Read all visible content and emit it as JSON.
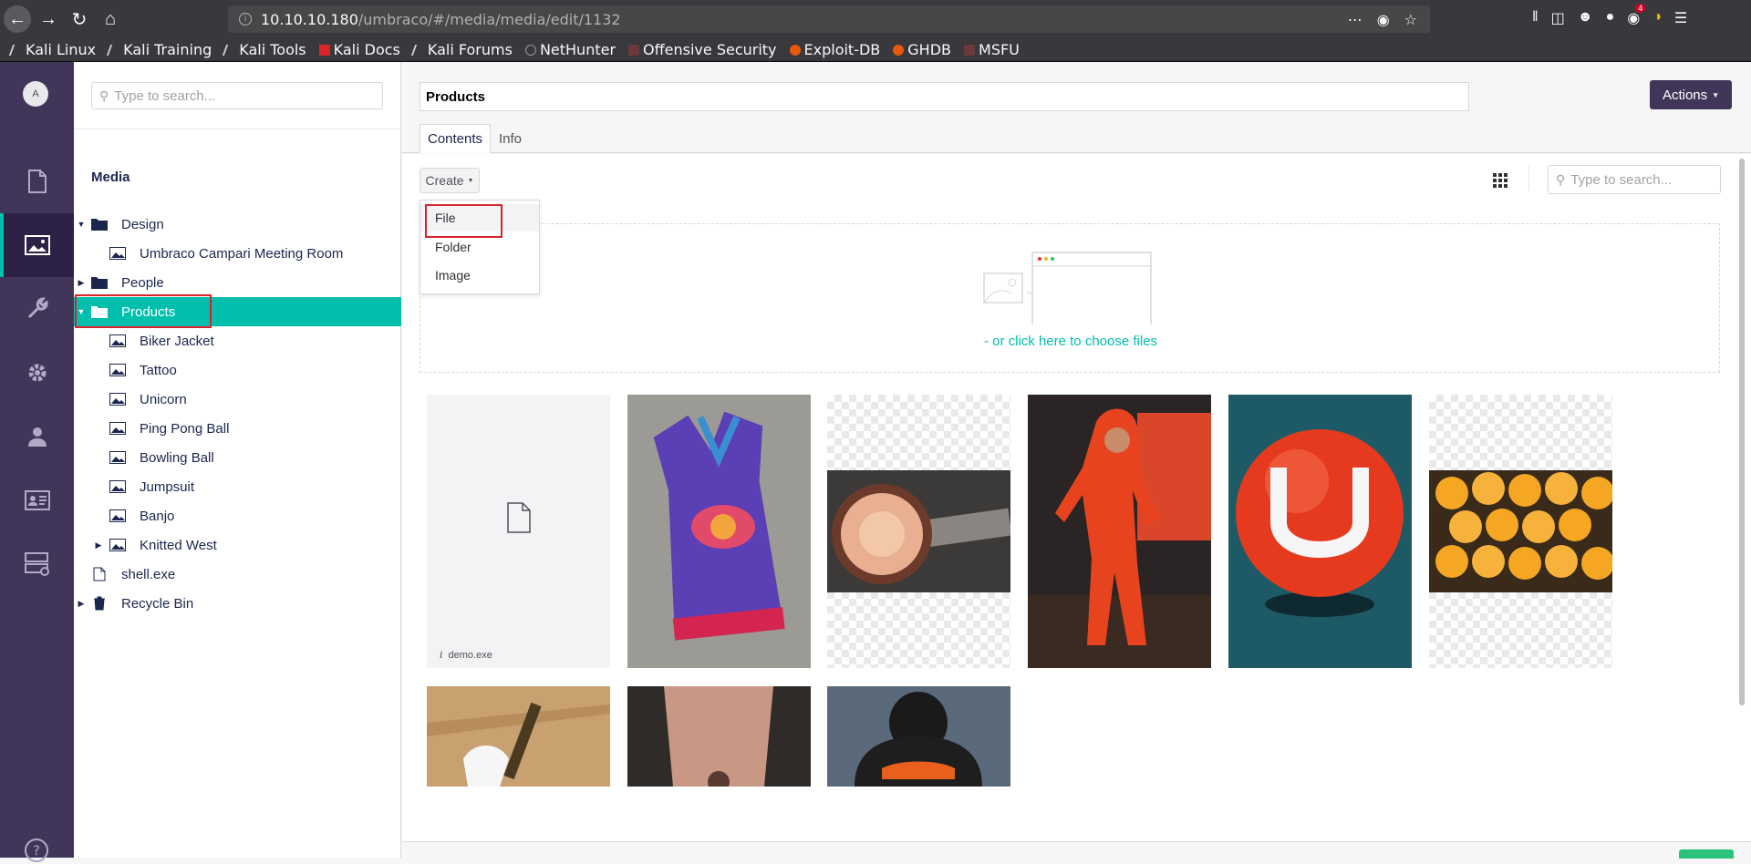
{
  "browser": {
    "url_prefix": "10.10.10.180",
    "url_path": "/umbraco/#/media/media/edit/1132",
    "extension_badge": "4",
    "bookmarks": [
      {
        "label": "Kali Linux"
      },
      {
        "label": "Kali Training"
      },
      {
        "label": "Kali Tools"
      },
      {
        "label": "Kali Docs"
      },
      {
        "label": "Kali Forums"
      },
      {
        "label": "NetHunter"
      },
      {
        "label": "Offensive Security"
      },
      {
        "label": "Exploit-DB"
      },
      {
        "label": "GHDB"
      },
      {
        "label": "MSFU"
      }
    ]
  },
  "section_nav": {
    "avatar_initial": "A",
    "items": [
      {
        "name": "content",
        "icon": "document-icon"
      },
      {
        "name": "media",
        "icon": "image-icon",
        "active": true
      },
      {
        "name": "settings",
        "icon": "wrench-icon"
      },
      {
        "name": "developer",
        "icon": "gear-icon"
      },
      {
        "name": "users",
        "icon": "user-icon"
      },
      {
        "name": "members",
        "icon": "id-card-icon"
      },
      {
        "name": "forms",
        "icon": "forms-icon"
      }
    ]
  },
  "tree": {
    "search_placeholder": "Type to search...",
    "title": "Media",
    "items": [
      {
        "label": "Design",
        "type": "folder",
        "expanded": true
      },
      {
        "label": "Umbraco Campari Meeting Room",
        "type": "image"
      },
      {
        "label": "People",
        "type": "folder",
        "expanded": false
      },
      {
        "label": "Products",
        "type": "folder",
        "expanded": true,
        "selected": true
      },
      {
        "label": "Biker Jacket",
        "type": "image"
      },
      {
        "label": "Tattoo",
        "type": "image"
      },
      {
        "label": "Unicorn",
        "type": "image"
      },
      {
        "label": "Ping Pong Ball",
        "type": "image"
      },
      {
        "label": "Bowling Ball",
        "type": "image"
      },
      {
        "label": "Jumpsuit",
        "type": "image"
      },
      {
        "label": "Banjo",
        "type": "image"
      },
      {
        "label": "Knitted West",
        "type": "image",
        "expandable": true
      },
      {
        "label": "shell.exe",
        "type": "file"
      },
      {
        "label": "Recycle Bin",
        "type": "trash",
        "expandable": true
      }
    ]
  },
  "editor": {
    "name_value": "Products",
    "actions_label": "Actions",
    "tabs": [
      {
        "label": "Contents",
        "active": true
      },
      {
        "label": "Info"
      }
    ],
    "create_label": "Create",
    "create_menu": [
      {
        "label": "File"
      },
      {
        "label": "Folder"
      },
      {
        "label": "Image"
      }
    ],
    "list_search_placeholder": "Type to search...",
    "choose_files": "- or click here to choose files",
    "file_caption": "demo.exe"
  },
  "colors": {
    "accent": "#00bfad",
    "nav_bg": "#413659",
    "highlight": "#d9252a",
    "save": "#2bc37c"
  }
}
